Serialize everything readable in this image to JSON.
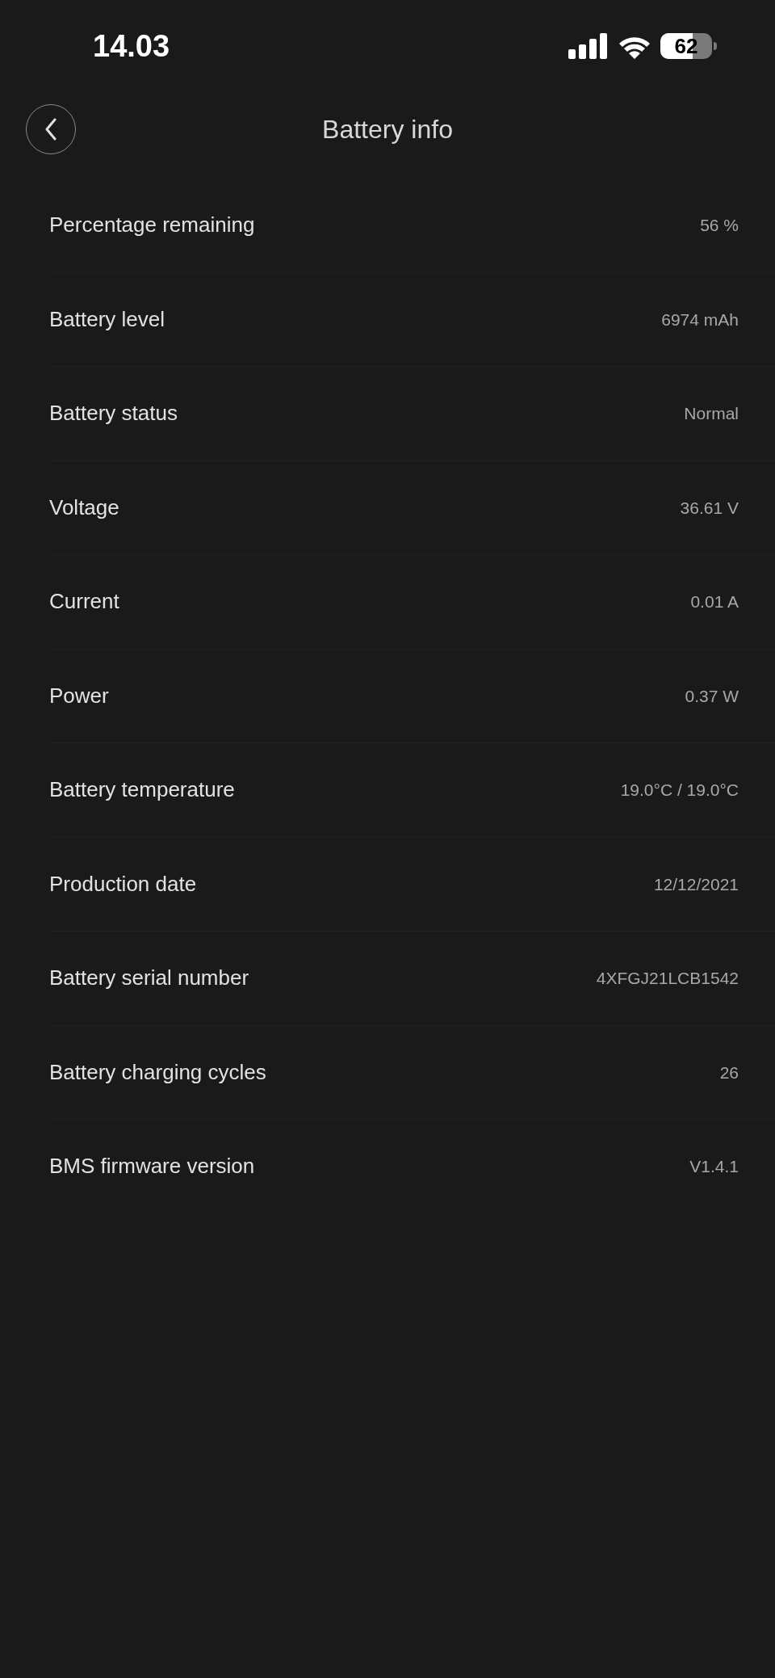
{
  "status_bar": {
    "time": "14.03",
    "battery_percent": "62"
  },
  "header": {
    "title": "Battery info"
  },
  "rows": [
    {
      "label": "Percentage remaining",
      "value": "56 %"
    },
    {
      "label": "Battery level",
      "value": "6974 mAh"
    },
    {
      "label": "Battery status",
      "value": "Normal"
    },
    {
      "label": "Voltage",
      "value": "36.61 V"
    },
    {
      "label": "Current",
      "value": "0.01 A"
    },
    {
      "label": "Power",
      "value": "0.37 W"
    },
    {
      "label": "Battery temperature",
      "value": "19.0°C / 19.0°C"
    },
    {
      "label": "Production date",
      "value": "12/12/2021"
    },
    {
      "label": "Battery serial number",
      "value": "4XFGJ21LCB1542"
    },
    {
      "label": "Battery charging cycles",
      "value": "26"
    },
    {
      "label": "BMS firmware version",
      "value": "V1.4.1"
    }
  ]
}
